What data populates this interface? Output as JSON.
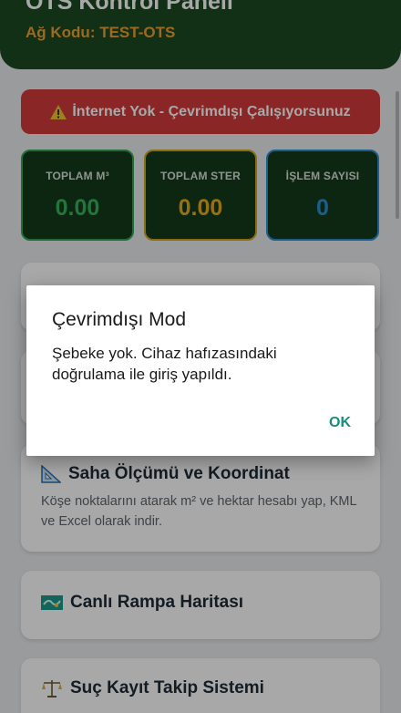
{
  "header": {
    "title": "OTS Kontrol Paneli",
    "ag_code": "Ağ Kodu: TEST-OTS"
  },
  "offline_banner": {
    "text": "İnternet Yok - Çevrimdışı Çalışıyorsunuz",
    "icon": "warning-icon",
    "color": "#d33a3a"
  },
  "stats": [
    {
      "label": "TOPLAM M³",
      "value": "0.00",
      "color": "#34b35a"
    },
    {
      "label": "TOPLAM STER",
      "value": "0.00",
      "color": "#e5ac1a"
    },
    {
      "label": "İŞLEM SAYISI",
      "value": "0",
      "color": "#2b8fd4"
    }
  ],
  "cards": [
    {
      "title": "Saha Ölçümü ve Koordinat",
      "icon": "triangle-ruler-icon",
      "description": "Köşe noktalarını atarak m² ve hektar hesabı yap, KML ve Excel olarak indir."
    },
    {
      "title": "Canlı Rampa Haritası",
      "icon": "map-icon"
    },
    {
      "title": "Suç Kayıt Takip Sistemi",
      "icon": "balance-scale-icon"
    }
  ],
  "dialog": {
    "title": "Çevrimdışı Mod",
    "message": "Şebeke yok. Cihaz hafızasındaki doğrulama ile giriş yapıldı.",
    "ok_label": "OK"
  }
}
